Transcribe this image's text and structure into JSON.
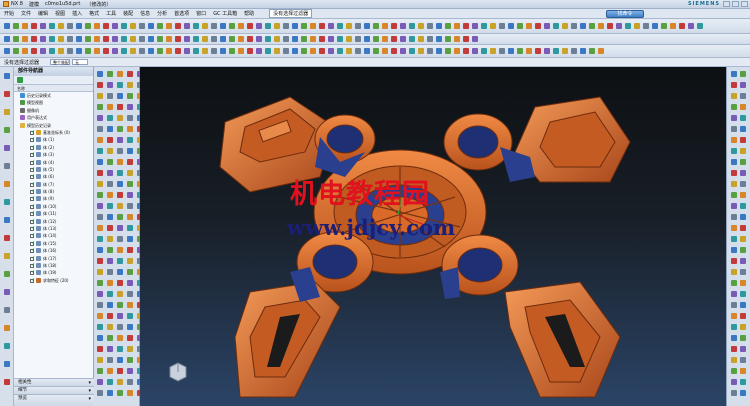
{
  "titlebar": {
    "app": "NX 8",
    "mode": "建模",
    "file": "c0mo1u5d.prt",
    "state": "（修改的）",
    "brand": "SIEMENS"
  },
  "menu": {
    "items": [
      "开始",
      "文件",
      "编辑",
      "视图",
      "插入",
      "格式",
      "工具",
      "装配",
      "信息",
      "分析",
      "首选项",
      "窗口",
      "GC 工具箱",
      "帮助"
    ],
    "select": "没有选择过滤器",
    "search_label": "找命令"
  },
  "filterbar": {
    "label": "没有选择过滤器",
    "scope": "整个装配",
    "option": "无"
  },
  "navigator": {
    "title": "部件导航器",
    "subtitle": "历史记录模式",
    "column": "名称",
    "rows": [
      {
        "label": "历史记录模式",
        "depth": 1,
        "icon": "history-icon"
      },
      {
        "label": "模型视图",
        "depth": 1,
        "icon": "views-icon"
      },
      {
        "label": "摄像机",
        "depth": 1,
        "icon": "camera-icon"
      },
      {
        "label": "用户表达式",
        "depth": 1,
        "icon": "expression-icon"
      },
      {
        "label": "模型历史记录",
        "depth": 1,
        "icon": "folder-icon"
      },
      {
        "label": "基准坐标系 (0)",
        "depth": 2,
        "icon": "csys-icon"
      },
      {
        "label": "体 (1)",
        "depth": 2,
        "icon": "body-icon"
      },
      {
        "label": "体 (2)",
        "depth": 2,
        "icon": "body-icon"
      },
      {
        "label": "体 (3)",
        "depth": 2,
        "icon": "body-icon"
      },
      {
        "label": "体 (4)",
        "depth": 2,
        "icon": "body-icon"
      },
      {
        "label": "体 (5)",
        "depth": 2,
        "icon": "body-icon"
      },
      {
        "label": "体 (6)",
        "depth": 2,
        "icon": "body-icon"
      },
      {
        "label": "体 (7)",
        "depth": 2,
        "icon": "body-icon"
      },
      {
        "label": "体 (8)",
        "depth": 2,
        "icon": "body-icon"
      },
      {
        "label": "体 (9)",
        "depth": 2,
        "icon": "body-icon"
      },
      {
        "label": "体 (10)",
        "depth": 2,
        "icon": "body-icon"
      },
      {
        "label": "体 (11)",
        "depth": 2,
        "icon": "body-icon"
      },
      {
        "label": "体 (12)",
        "depth": 2,
        "icon": "body-icon"
      },
      {
        "label": "体 (13)",
        "depth": 2,
        "icon": "body-icon"
      },
      {
        "label": "体 (14)",
        "depth": 2,
        "icon": "body-icon"
      },
      {
        "label": "体 (15)",
        "depth": 2,
        "icon": "body-icon"
      },
      {
        "label": "体 (16)",
        "depth": 2,
        "icon": "body-icon"
      },
      {
        "label": "体 (17)",
        "depth": 2,
        "icon": "body-icon"
      },
      {
        "label": "体 (18)",
        "depth": 2,
        "icon": "body-icon"
      },
      {
        "label": "体 (19)",
        "depth": 2,
        "icon": "body-icon"
      },
      {
        "label": "求和特征 (20)",
        "depth": 2,
        "icon": "unite-icon"
      }
    ],
    "sections": [
      "相关性",
      "细节",
      "预览"
    ]
  },
  "watermark": {
    "cn": "机电教程园",
    "url": "www.jdjcy.com"
  },
  "colors": {
    "part": "#d96a2a",
    "part_dark": "#8b3b12",
    "cavity": "#2a3f8e",
    "watermark_red": "#e1121e",
    "watermark_blue": "#1c1f78"
  }
}
